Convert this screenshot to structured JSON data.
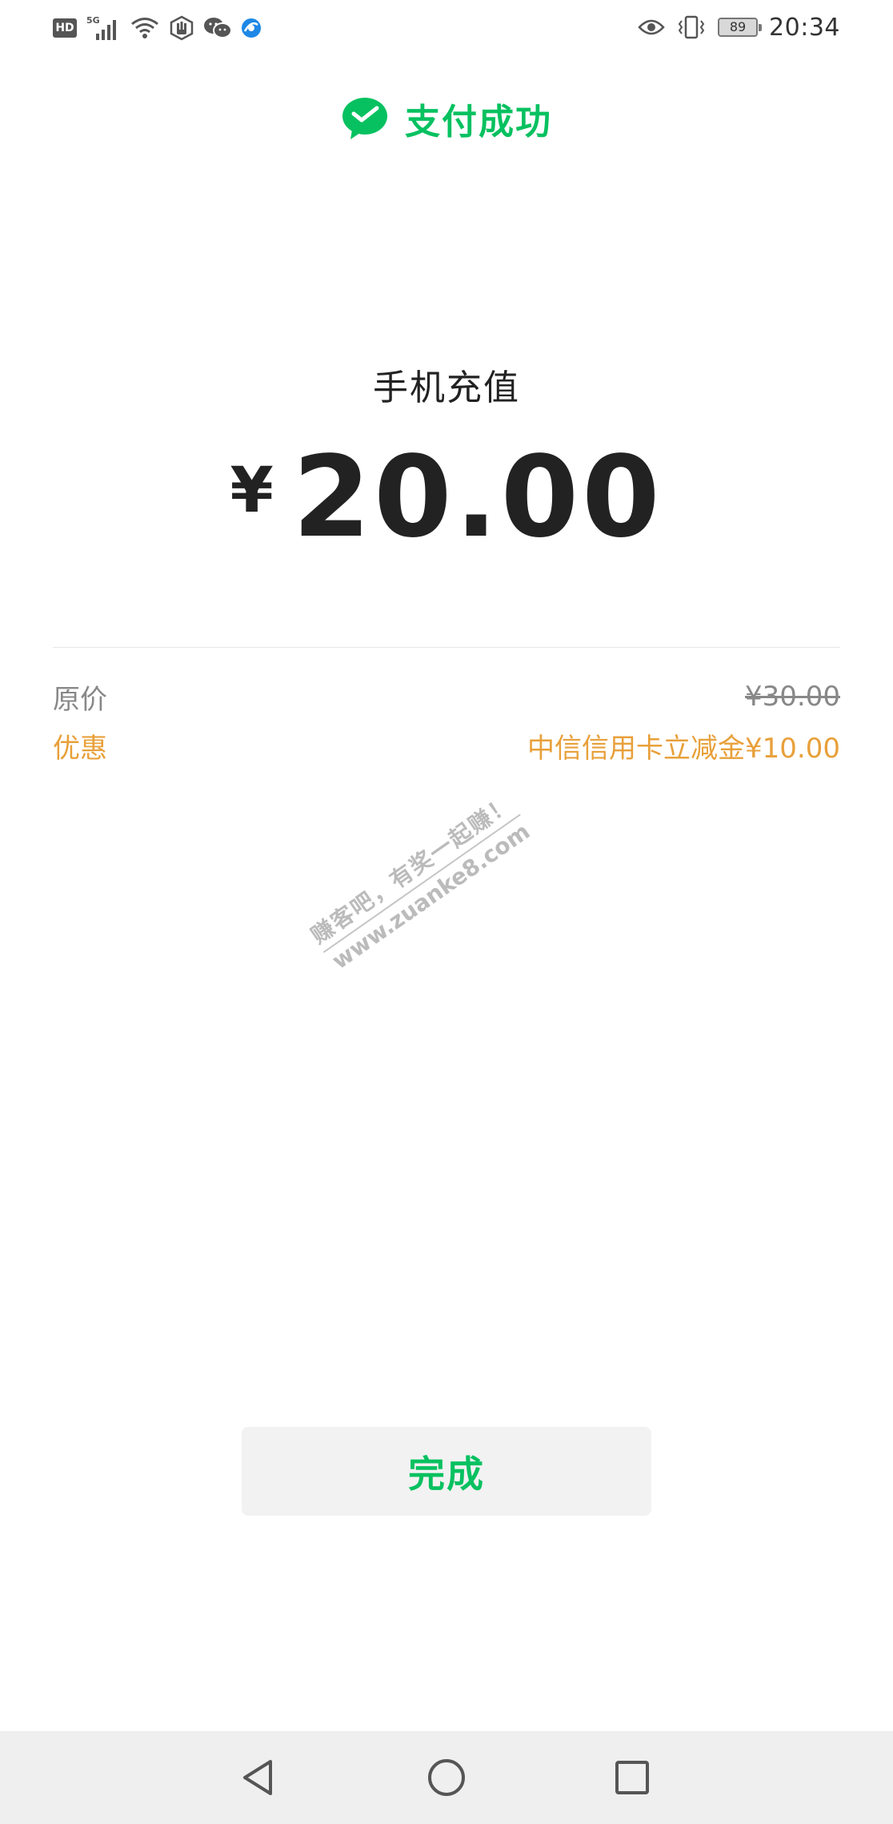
{
  "status_bar": {
    "hd_label": "HD",
    "network_label": "5G",
    "battery_level": "89",
    "time": "20:34",
    "left_icons": [
      "hd-icon",
      "signal-5g-icon",
      "wifi-icon",
      "hand-icon",
      "wechat-icon",
      "browser-icon"
    ],
    "right_icons": [
      "eye-icon",
      "vibrate-icon",
      "battery-icon"
    ]
  },
  "header": {
    "logo_icon": "wechat-pay-logo-icon",
    "title": "支付成功"
  },
  "payment": {
    "merchant": "手机充值",
    "currency_symbol": "¥",
    "amount": "20.00"
  },
  "details": {
    "original_label": "原价",
    "original_value": "¥30.00",
    "discount_label": "优惠",
    "discount_value": "中信信用卡立减金¥10.00"
  },
  "watermark": {
    "line1": "赚客吧，有奖一起赚！",
    "line2": "www.zuanke8.com"
  },
  "actions": {
    "done_label": "完成"
  },
  "nav_bar": {
    "icons": [
      "back-triangle-icon",
      "home-circle-icon",
      "recent-square-icon"
    ]
  },
  "colors": {
    "accent_green": "#07c160",
    "discount_orange": "#e8a03a",
    "text_dark": "#222222",
    "text_grey": "#888888",
    "button_bg": "#f2f2f2",
    "nav_bg": "#efefef"
  }
}
